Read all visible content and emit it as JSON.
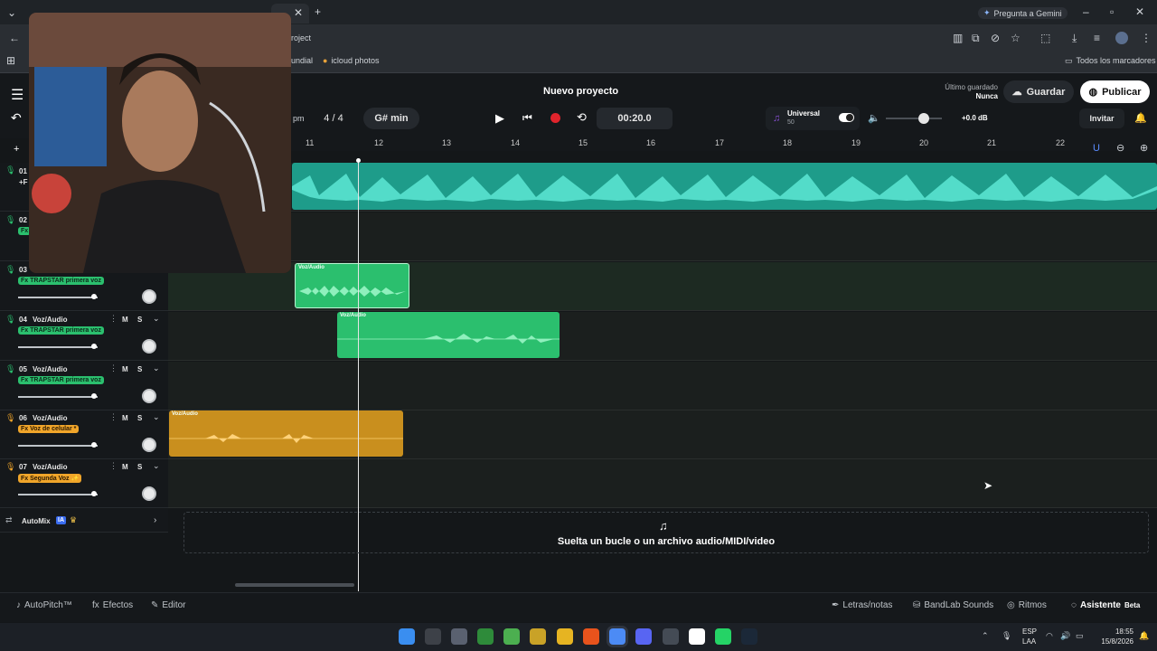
{
  "browser": {
    "tab_title": "project",
    "gemini": "Pregunta a Gemini",
    "address_suffix": "roject",
    "bookmarks": [
      "undial",
      "icloud photos"
    ],
    "all_bookmarks": "Todos los marcadores"
  },
  "header": {
    "project_title": "Nuevo proyecto",
    "last_saved_label": "Último guardado",
    "last_saved_value": "Nunca",
    "save_label": "Guardar",
    "publish_label": "Publicar",
    "invite_label": "Invitar",
    "bpm_suffix": "pm",
    "time_signature": "4 / 4",
    "key": "G# min",
    "time_display": "00:20.0",
    "instrument_name": "Universal",
    "instrument_value": "50",
    "volume_db": "+0.0 dB"
  },
  "ruler": {
    "ticks": [
      "11",
      "12",
      "13",
      "14",
      "15",
      "16",
      "17",
      "18",
      "19",
      "20",
      "21",
      "22"
    ]
  },
  "tracks": [
    {
      "num": "01",
      "name": "",
      "fx": "+F",
      "color": "green"
    },
    {
      "num": "02",
      "name": "",
      "fx": "Fx",
      "color": "green"
    },
    {
      "num": "03",
      "name": "",
      "fx": "Fx TRAPSTAR primera voz",
      "color": "green"
    },
    {
      "num": "04",
      "name": "Voz/Audio",
      "fx": "Fx TRAPSTAR primera voz",
      "color": "green"
    },
    {
      "num": "05",
      "name": "Voz/Audio",
      "fx": "Fx TRAPSTAR primera voz",
      "color": "green"
    },
    {
      "num": "06",
      "name": "Voz/Audio",
      "fx": "Fx Voz de celular *",
      "color": "orange"
    },
    {
      "num": "07",
      "name": "Voz/Audio",
      "fx": "Fx Segunda Voz ✨",
      "color": "orange"
    }
  ],
  "track_buttons": {
    "mute": "M",
    "solo": "S"
  },
  "clips": {
    "clip3": "Voz/Audio",
    "clip4": "Voz/Audio",
    "clip6": "Voz/Audio"
  },
  "automix": {
    "label": "AutoMix",
    "badge": "IA"
  },
  "dropzone": "Suelta un bucle o un archivo audio/MIDI/video",
  "bottom": {
    "autopitch": "AutoPitch™",
    "effects": "Efectos",
    "editor": "Editor",
    "lyrics": "Letras/notas",
    "sounds": "BandLab Sounds",
    "rhythms": "Ritmos",
    "assistant": "Asistente",
    "beta": "Beta"
  },
  "taskbar": {
    "lang1": "ESP",
    "lang2": "LAA",
    "time": "18:55",
    "date": "15/8/2026"
  },
  "colors": {
    "accent_teal": "#22c7a9",
    "clip_green": "#2bbf6e",
    "clip_orange": "#e2a22a",
    "record_red": "#e0242c"
  }
}
